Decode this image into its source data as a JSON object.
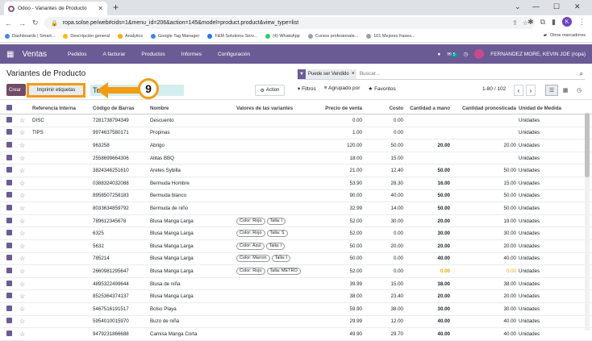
{
  "browser": {
    "tab_title": "Odoo - Variantes de Producto",
    "url": "ropa.solse.pe/web#cids=1&menu_id=206&action=145&model=product.product&view_type=list",
    "profile_initial": "K",
    "bookmarks": [
      "Dashboards | Smart...",
      "Descripción general",
      "Analytics",
      "Google Tag Manager",
      "F&M Solutions Serv...",
      "(4) WhatsApp",
      "Cursos profesionale...",
      "101 Mejores frases..."
    ],
    "other_bookmarks": "Otros marcadores"
  },
  "navbar": {
    "app": "Ventas",
    "menu": [
      "Pedidos",
      "A facturar",
      "Productos",
      "Informes",
      "Configuración"
    ],
    "badge": "5",
    "user": "FERNANDEZ MORE, KEVIN JOE (ropa)"
  },
  "control": {
    "breadcrumb": "Variantes de Producto",
    "create": "Crear",
    "print_labels": "Imprimir etiquetas",
    "select_all": "Todo seleccionado",
    "action": "Action",
    "callout": "9",
    "facet": "Puede ser Vendido",
    "search_placeholder": "Buscar...",
    "filters": "Filtros",
    "group_by": "Agrupado por",
    "favorites": "Favoritos",
    "pager": "1-80 / 102"
  },
  "table": {
    "headers": [
      "Referencia Interna",
      "Código de Barras",
      "Nombre",
      "Valores de las variantes",
      "Precio de venta",
      "Costo",
      "Cantidad a mano",
      "Cantidad pronosticada",
      "Unidad de Medida"
    ],
    "rows": [
      {
        "ref": "DISC",
        "code": "7281738794349",
        "name": "Descuento",
        "attrs": [],
        "price": "0.00",
        "cost": "0.00",
        "qty": "",
        "fc": "",
        "uom": "Unidades"
      },
      {
        "ref": "TIPS",
        "code": "9974637580171",
        "name": "Propinas",
        "attrs": [],
        "price": "1.00",
        "cost": "0.00",
        "qty": "",
        "fc": "",
        "uom": "Unidades"
      },
      {
        "ref": "",
        "code": "963258",
        "name": "Abrigo",
        "attrs": [],
        "price": "120.00",
        "cost": "50.00",
        "qty": "20.00",
        "fc": "20.00",
        "uom": "Unidades"
      },
      {
        "ref": "",
        "code": "2558699664306",
        "name": "Alitas BBQ",
        "attrs": [],
        "price": "18.00",
        "cost": "15.00",
        "qty": "",
        "fc": "",
        "uom": "Unidades"
      },
      {
        "ref": "",
        "code": "3824346251610",
        "name": "Aretes Sybilla",
        "attrs": [],
        "price": "21.00",
        "cost": "12.40",
        "qty": "50.00",
        "fc": "50.00",
        "uom": "Unidades"
      },
      {
        "ref": "",
        "code": "0388324032088",
        "name": "Bermuda Hombre",
        "attrs": [],
        "price": "53.90",
        "cost": "28.30",
        "qty": "16.00",
        "fc": "15.00",
        "uom": "Unidades"
      },
      {
        "ref": "",
        "code": "8958507258183",
        "name": "Bermuda blanco",
        "attrs": [],
        "price": "90.00",
        "cost": "40.00",
        "qty": "50.00",
        "fc": "50.00",
        "uom": "Unidades"
      },
      {
        "ref": "",
        "code": "8033634859792",
        "name": "Bermuda de niño",
        "attrs": [],
        "price": "32.99",
        "cost": "14.00",
        "qty": "50.00",
        "fc": "50.00",
        "uom": "Unidades"
      },
      {
        "ref": "",
        "code": "789612345678",
        "name": "Blusa Manga Larga",
        "attrs": [
          "Color: Rojo",
          "Talla: l"
        ],
        "price": "52.00",
        "cost": "30.00",
        "qty": "20.00",
        "fc": "19.00",
        "uom": "Unidades"
      },
      {
        "ref": "",
        "code": "6325",
        "name": "Blusa Manga Larga",
        "attrs": [
          "Color: Rojo",
          "Talla: S"
        ],
        "price": "52.00",
        "cost": "0.00",
        "qty": "30.00",
        "fc": "30.00",
        "uom": "Unidades"
      },
      {
        "ref": "",
        "code": "5632",
        "name": "Blusa Manga Larga",
        "attrs": [
          "Color: Azul",
          "Talla: l"
        ],
        "price": "50.00",
        "cost": "20.00",
        "qty": "20.00",
        "fc": "20.00",
        "uom": "Unidades"
      },
      {
        "ref": "",
        "code": "785214",
        "name": "Blusa Manga Larga",
        "attrs": [
          "Color: Marron",
          "Talla: l"
        ],
        "price": "50.00",
        "cost": "0.00",
        "qty": "40.00",
        "fc": "40.00",
        "uom": "Unidades"
      },
      {
        "ref": "",
        "code": "2660981295647",
        "name": "Blusa Manga Larga",
        "attrs": [
          "Color: Rojo",
          "Talla: METRO"
        ],
        "price": "52.00",
        "cost": "0.00",
        "qty": "0.00",
        "fc": "0.00",
        "uom": "Unidades",
        "warn": true
      },
      {
        "ref": "",
        "code": "4895322499644",
        "name": "Blusa de niña",
        "attrs": [],
        "price": "39.99",
        "cost": "15.00",
        "qty": "38.00",
        "fc": "38.00",
        "uom": "Unidades"
      },
      {
        "ref": "",
        "code": "8525364374137",
        "name": "Blusa Manga Larga",
        "attrs": [],
        "price": "38.00",
        "cost": "23.40",
        "qty": "20.00",
        "fc": "20.00",
        "uom": "Unidades"
      },
      {
        "ref": "",
        "code": "5467516191517",
        "name": "Bolso Playa",
        "attrs": [],
        "price": "59.90",
        "cost": "38.00",
        "qty": "30.00",
        "fc": "30.00",
        "uom": "Unidades"
      },
      {
        "ref": "",
        "code": "5954010015970",
        "name": "Buzo de niña",
        "attrs": [],
        "price": "29.99",
        "cost": "12.00",
        "qty": "40.00",
        "fc": "40.00",
        "uom": "Unidades"
      },
      {
        "ref": "",
        "code": "9479231866688",
        "name": "Camisa Manga Corta",
        "attrs": [],
        "price": "49.90",
        "cost": "29.70",
        "qty": "40.00",
        "fc": "40.00",
        "uom": "Unidades"
      }
    ]
  }
}
